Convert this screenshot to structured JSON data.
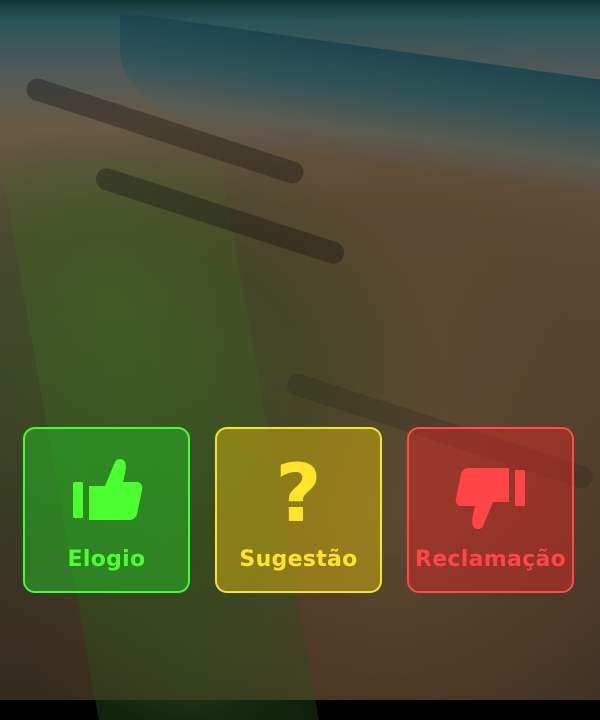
{
  "feedback": {
    "options": [
      {
        "label": "Elogio",
        "icon": "thumbs-up-icon",
        "color": "#44ff2f"
      },
      {
        "label": "Sugestão",
        "icon": "question-mark-icon",
        "color": "#f3e62a"
      },
      {
        "label": "Reclamação",
        "icon": "thumbs-down-icon",
        "color": "#ff4b4b"
      }
    ]
  }
}
